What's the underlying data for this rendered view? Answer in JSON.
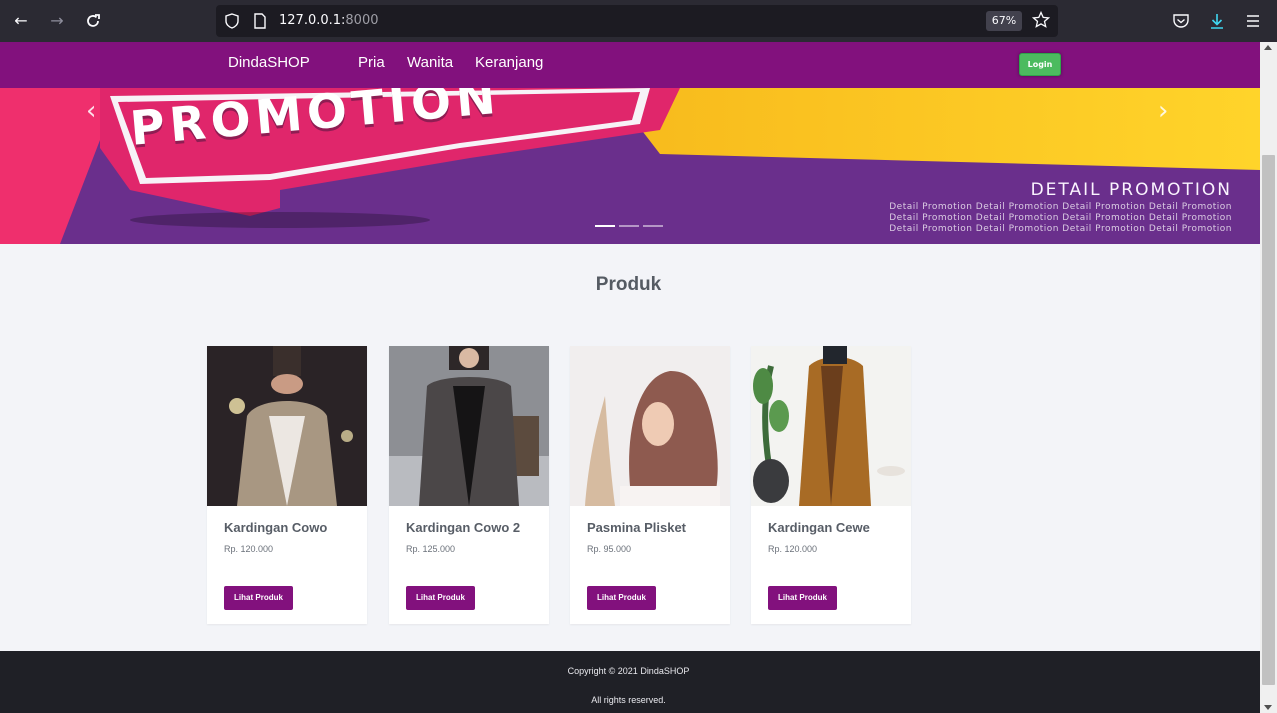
{
  "browser": {
    "url_host": "127.0.0.1:",
    "url_port": "8000",
    "zoom": "67%"
  },
  "navbar": {
    "brand": "DindaSHOP",
    "links": [
      "Pria",
      "Wanita",
      "Keranjang"
    ],
    "login_label": "Login"
  },
  "banner": {
    "headline": "PROMOTION",
    "detail_title": "DETAIL PROMOTION",
    "detail_lines": [
      "Detail Promotion Detail Promotion Detail Promotion Detail Promotion",
      "Detail Promotion Detail Promotion Detail Promotion Detail Promotion",
      "Detail Promotion Detail Promotion Detail Promotion Detail Promotion"
    ],
    "prev_icon": "chevron-left-icon",
    "next_icon": "chevron-right-icon",
    "slides": 3,
    "active_slide": 1
  },
  "products_section": {
    "title": "Produk",
    "items": [
      {
        "name": "Kardingan Cowo",
        "price": "Rp. 120.000",
        "button": "Lihat Produk"
      },
      {
        "name": "Kardingan Cowo 2",
        "price": "Rp. 125.000",
        "button": "Lihat Produk"
      },
      {
        "name": "Pasmina Plisket",
        "price": "Rp. 95.000",
        "button": "Lihat Produk"
      },
      {
        "name": "Kardingan Cewe",
        "price": "Rp. 120.000",
        "button": "Lihat Produk"
      }
    ]
  },
  "footer": {
    "copyright": "Copyright © 2021 DindaSHOP",
    "rights": "All rights reserved."
  },
  "colors": {
    "brand": "#82117d",
    "login": "#4cbb5f",
    "footer": "#1f2026"
  }
}
